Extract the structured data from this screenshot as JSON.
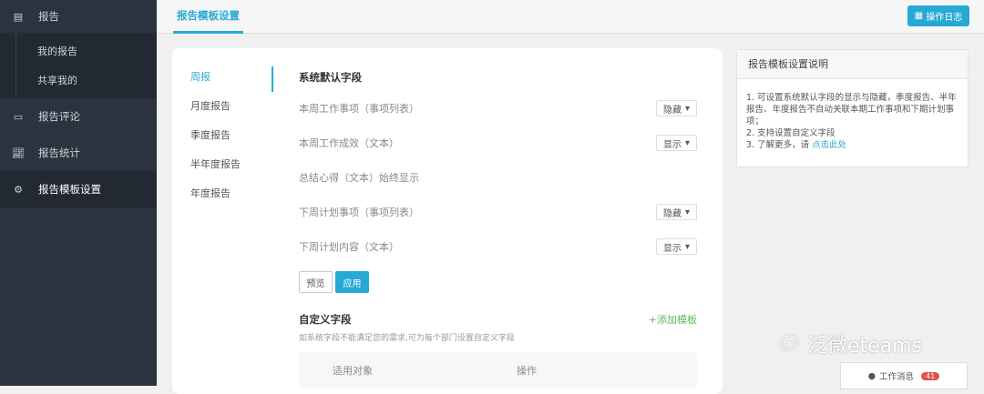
{
  "sidebar": {
    "items": [
      {
        "label": "报告",
        "icon": "report-icon"
      },
      {
        "label": "我的报告"
      },
      {
        "label": "共享我的"
      },
      {
        "label": "报告评论",
        "icon": "comment-icon"
      },
      {
        "label": "报告统计",
        "icon": "chart-icon"
      },
      {
        "label": "报告模板设置",
        "icon": "gear-icon"
      }
    ]
  },
  "header": {
    "tab": "报告模板设置",
    "log_button": "操作日志"
  },
  "vtabs": [
    "周报",
    "月度报告",
    "季度报告",
    "半年度报告",
    "年度报告"
  ],
  "system": {
    "title": "系统默认字段",
    "rows": [
      {
        "label": "本周工作事项（事项列表）",
        "value": "隐藏"
      },
      {
        "label": "本周工作成效（文本）",
        "value": "显示"
      },
      {
        "label": "总结心得（文本）始终显示",
        "value": null
      },
      {
        "label": "下周计划事项（事项列表）",
        "value": "隐藏"
      },
      {
        "label": "下周计划内容（文本）",
        "value": "显示"
      }
    ],
    "preview": "预览",
    "apply": "应用"
  },
  "custom": {
    "title": "自定义字段",
    "add": "+添加模板",
    "desc": "如系统字段不能满足您的需求,可为每个部门设置自定义字段",
    "col1": "适用对象",
    "col2": "操作"
  },
  "info": {
    "title": "报告模板设置说明",
    "line1": "1. 可设置系统默认字段的显示与隐藏，季度报告、半年报告、年度报告不自动关联本期工作事项和下期计划事项；",
    "line2": "2. 支持设置自定义字段",
    "line3": "3. 了解更多，请 ",
    "link": "点击此处"
  },
  "watermark": "泛微eteams",
  "messages": {
    "label": "工作消息",
    "count": "41"
  }
}
